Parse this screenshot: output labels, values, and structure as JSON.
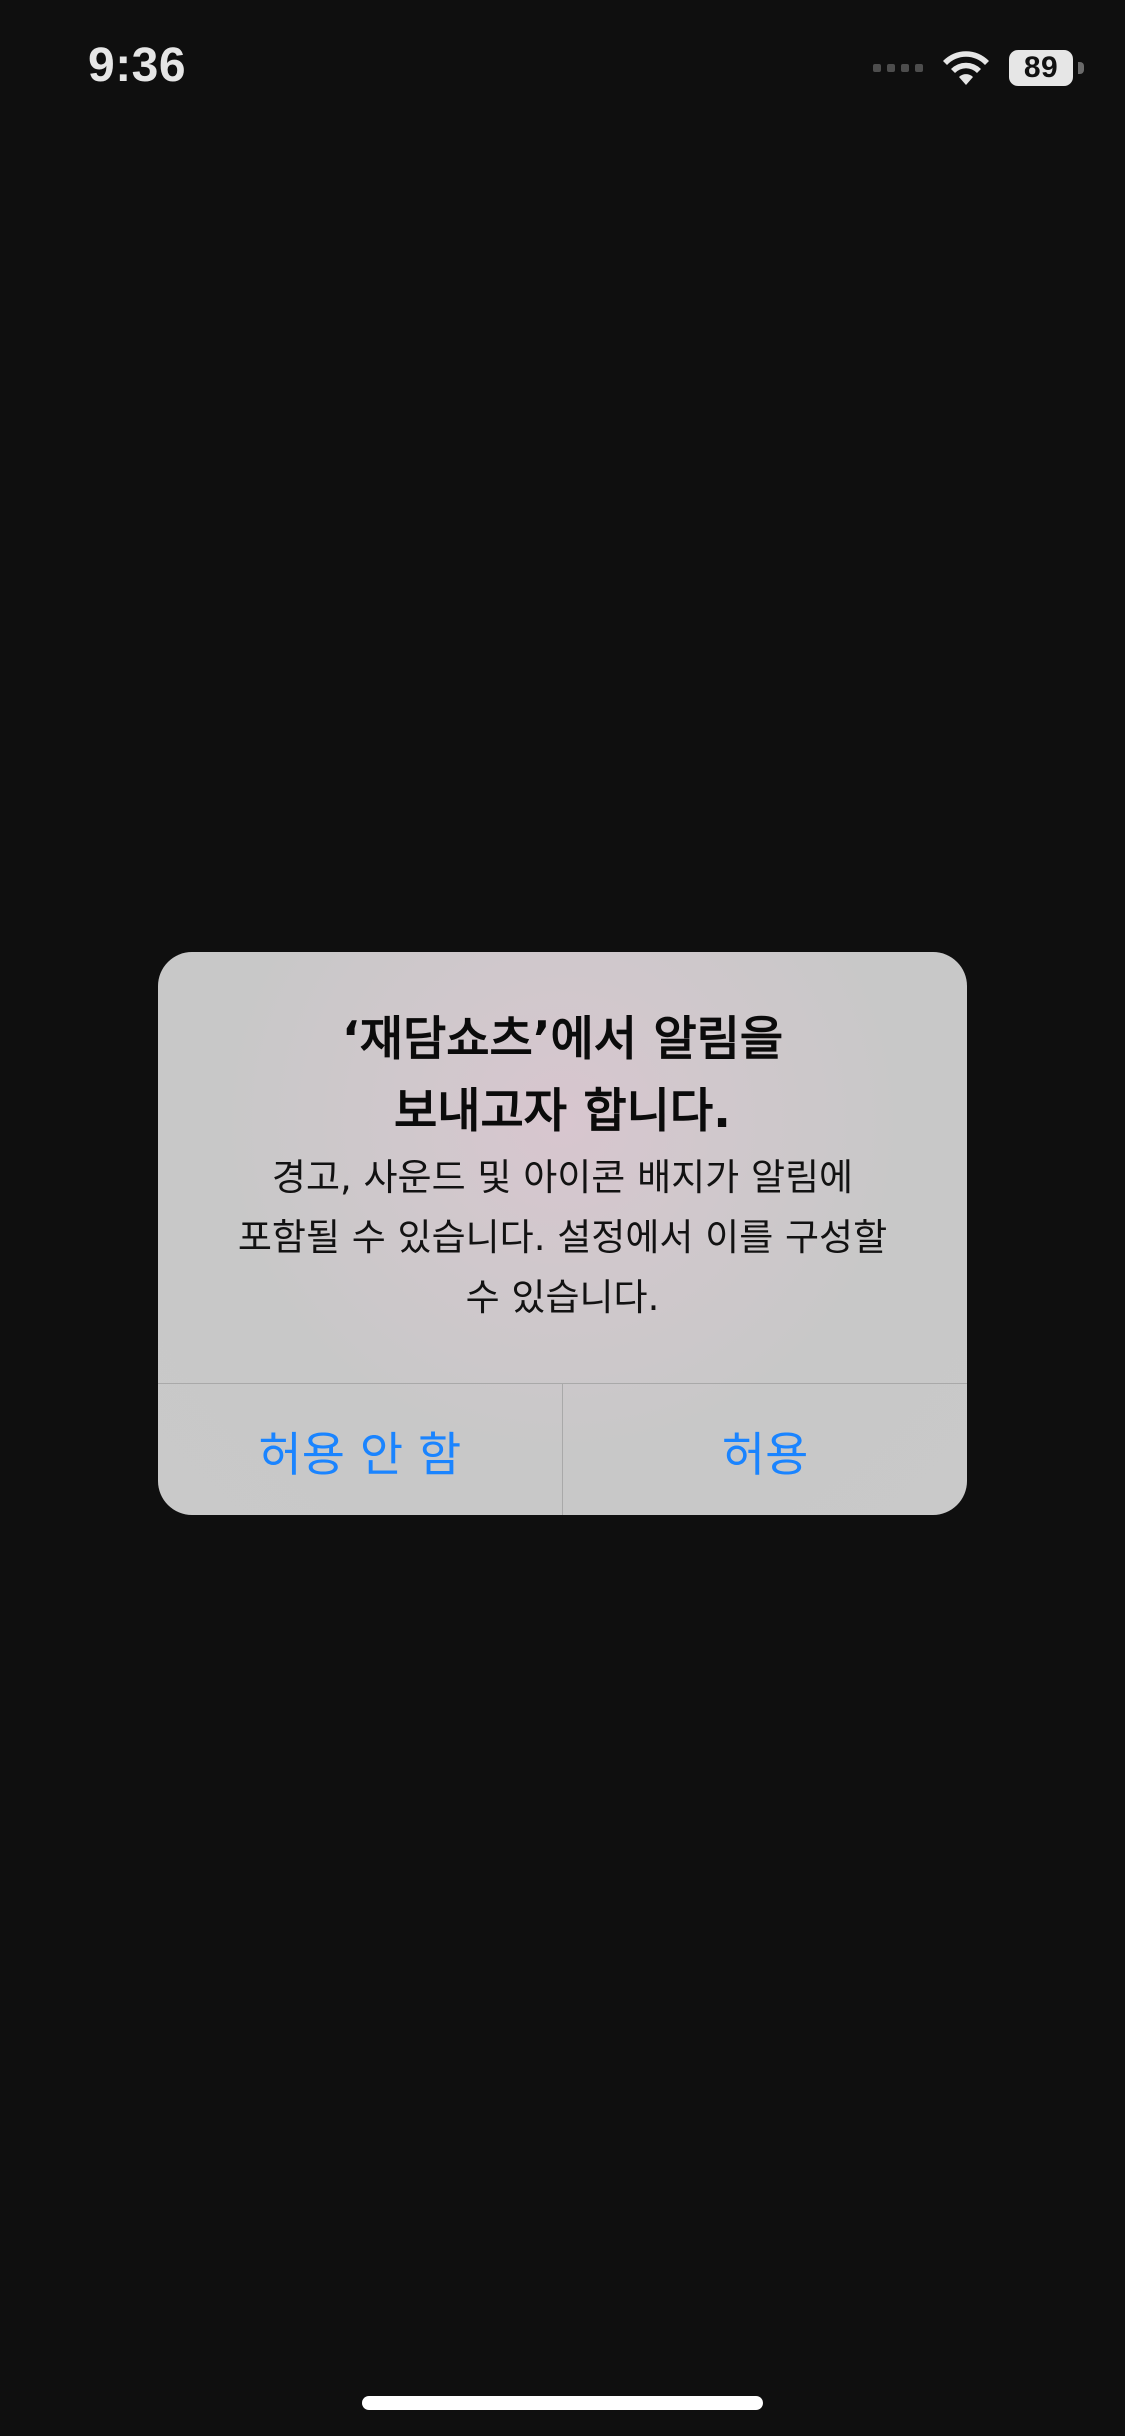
{
  "status_bar": {
    "time": "9:36",
    "battery_level": "89",
    "icons": [
      "signal-dots-icon",
      "wifi-icon",
      "battery-icon"
    ]
  },
  "alert": {
    "title": "‘재담쇼츠’에서 알림을\n보내고자 합니다.",
    "message": "경고, 사운드 및 아이콘 배지가 알림에\n포함될 수 있습니다. 설정에서 이를 구성할\n수 있습니다.",
    "buttons": {
      "deny_label": "허용 안 함",
      "allow_label": "허용"
    }
  },
  "colors": {
    "background": "#0f0f0f",
    "alert_background": "#c9c9c9",
    "button_text": "#1a84ff",
    "status_text": "#e6e6e6"
  }
}
